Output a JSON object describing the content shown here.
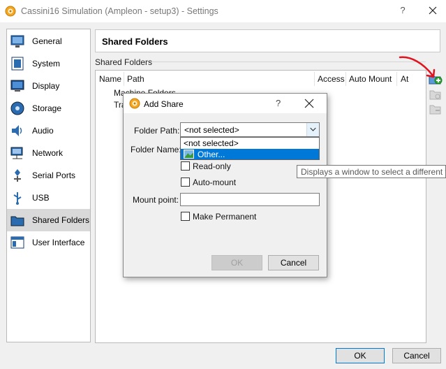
{
  "window": {
    "title": "Cassini16 Simulation (Ampleon - setup3) - Settings",
    "help_glyph": "?"
  },
  "sidebar": {
    "items": [
      {
        "label": "General",
        "icon": "general-icon"
      },
      {
        "label": "System",
        "icon": "system-icon"
      },
      {
        "label": "Display",
        "icon": "display-icon"
      },
      {
        "label": "Storage",
        "icon": "storage-icon"
      },
      {
        "label": "Audio",
        "icon": "audio-icon"
      },
      {
        "label": "Network",
        "icon": "network-icon"
      },
      {
        "label": "Serial Ports",
        "icon": "serial-ports-icon"
      },
      {
        "label": "USB",
        "icon": "usb-icon"
      },
      {
        "label": "Shared Folders",
        "icon": "shared-folders-icon",
        "selected": true
      },
      {
        "label": "User Interface",
        "icon": "user-interface-icon"
      }
    ]
  },
  "main": {
    "heading": "Shared Folders",
    "group_label": "Shared Folders",
    "columns": [
      "Name",
      "Path",
      "Access",
      "Auto Mount",
      "At"
    ],
    "tree_rows": [
      "Machine Folders",
      "Tra"
    ]
  },
  "buttons": {
    "ok": "OK",
    "cancel": "Cancel"
  },
  "dialog": {
    "title": "Add Share",
    "help_glyph": "?",
    "folder_path_label": "Folder Path:",
    "folder_path_value": "<not selected>",
    "folder_name_label": "Folder Name:",
    "dropdown_options": [
      "<not selected>",
      "Other..."
    ],
    "read_only_label": "Read-only",
    "auto_mount_label": "Auto-mount",
    "mount_point_label": "Mount point:",
    "mount_point_value": "",
    "make_permanent_label": "Make Permanent",
    "ok_label": "OK",
    "cancel_label": "Cancel"
  },
  "tooltip": {
    "text": "Displays a window to select a different folder."
  },
  "colors": {
    "selection": "#0078d7",
    "sidebar_selected": "#d9d9d9",
    "annotation_arrow": "#e0141e",
    "add_icon_green": "#2fa836"
  }
}
